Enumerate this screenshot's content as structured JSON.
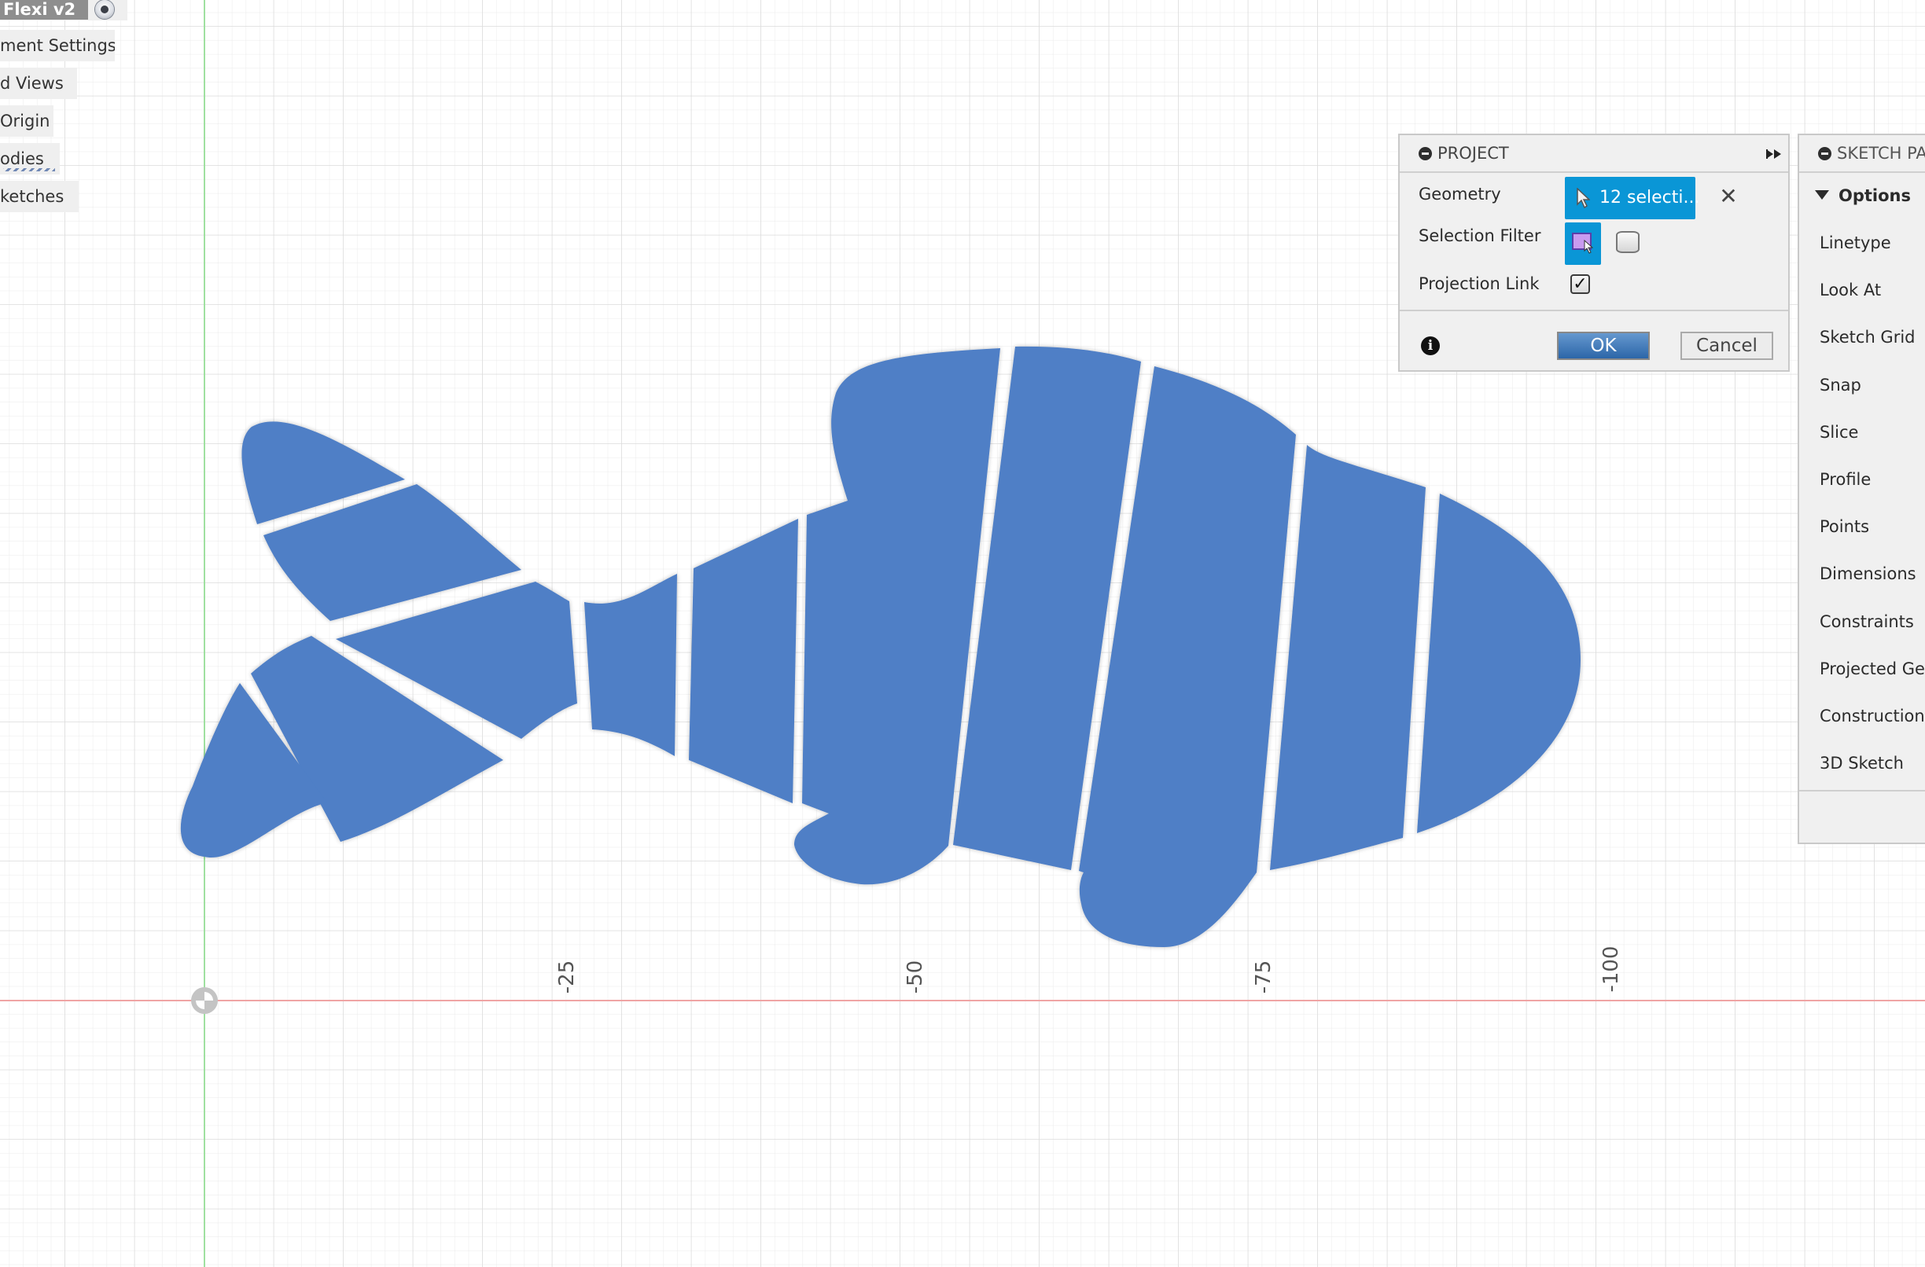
{
  "browser": {
    "component_title": "Flexi v2",
    "rows": [
      {
        "label": "ment Settings",
        "full_label": "Document Settings"
      },
      {
        "label": "d Views",
        "full_label": "Named Views"
      },
      {
        "label": "Origin",
        "full_label": "Origin"
      },
      {
        "label": "odies",
        "full_label": "Bodies"
      },
      {
        "label": "ketches",
        "full_label": "Sketches"
      }
    ]
  },
  "project_dialog": {
    "title": "PROJECT",
    "geometry_label": "Geometry",
    "geometry_value": "12 selecti...",
    "selection_filter_label": "Selection Filter",
    "projection_link_label": "Projection Link",
    "projection_link_checked": true,
    "check_glyph": "✓",
    "clear_glyph": "✕",
    "info_glyph": "i",
    "ok_label": "OK",
    "cancel_label": "Cancel"
  },
  "sketch_palette": {
    "title": "SKETCH PA",
    "section": "Options",
    "items": [
      "Linetype",
      "Look At",
      "Sketch Grid",
      "Snap",
      "Slice",
      "Profile",
      "Points",
      "Dimensions",
      "Constraints",
      "Projected Ge",
      "Construction",
      "3D Sketch"
    ]
  },
  "canvas": {
    "axis_ticks": [
      "-25",
      "-50",
      "-75",
      "-100"
    ],
    "selected_profiles": 12,
    "profile_color": "#4f7fc6",
    "x_axis_color": "#f0a4a4",
    "y_axis_color": "#9fe0a0"
  }
}
